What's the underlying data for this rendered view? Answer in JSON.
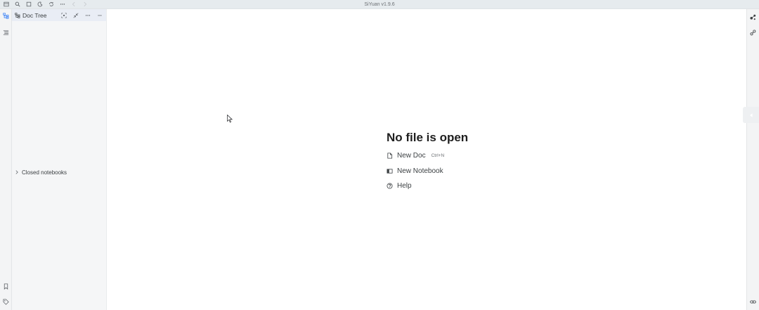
{
  "titlebar": {
    "app_title": "SiYuan v1.9.6",
    "icons": [
      "workspace-icon",
      "search-icon",
      "window-icon",
      "theme-moon-icon",
      "sync-icon",
      "more-icon",
      "back-icon",
      "forward-icon"
    ]
  },
  "left_dock": {
    "items": [
      "file-tree-icon",
      "outline-icon"
    ],
    "bottom_items": [
      "bookmark-icon",
      "tag-icon"
    ]
  },
  "doc_panel": {
    "title": "Doc Tree",
    "actions": [
      "focus-icon",
      "collapse-icon",
      "more-icon",
      "minimize-icon"
    ],
    "closed_notebooks_label": "Closed notebooks"
  },
  "main": {
    "empty_title": "No file is open",
    "new_doc_label": "New Doc",
    "new_doc_shortcut": "Ctrl+N",
    "new_notebook_label": "New Notebook",
    "help_label": "Help"
  },
  "right_dock": {
    "items": [
      "graph-icon",
      "global-graph-icon"
    ],
    "bottom_items": [
      "backlink-icon"
    ]
  },
  "colors": {
    "accent": "#3b82f6",
    "titlebar_bg": "#e6ebee",
    "panel_header_bg": "#e9edf5",
    "panel_bg": "#f5f6f7"
  }
}
